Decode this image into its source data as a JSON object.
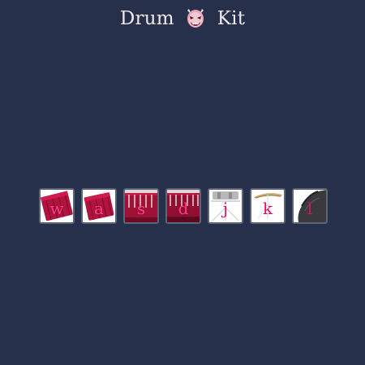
{
  "title": {
    "left": "Drum",
    "right": "Kit",
    "icon": "oni-mask-icon"
  },
  "pads": [
    {
      "key": "w",
      "icon": "tom-drum-icon"
    },
    {
      "key": "a",
      "icon": "tom-drum-icon"
    },
    {
      "key": "s",
      "icon": "snare-drum-icon"
    },
    {
      "key": "d",
      "icon": "bass-drum-icon"
    },
    {
      "key": "j",
      "icon": "hi-hat-stand-icon"
    },
    {
      "key": "k",
      "icon": "cymbal-icon"
    },
    {
      "key": "l",
      "icon": "crash-cymbal-icon"
    }
  ],
  "colors": {
    "background": "#27304b",
    "title": "#f1e8ee",
    "key_letter": "#ff3d8a",
    "drum": "#b0143e",
    "pad_border": "#5b6478"
  }
}
